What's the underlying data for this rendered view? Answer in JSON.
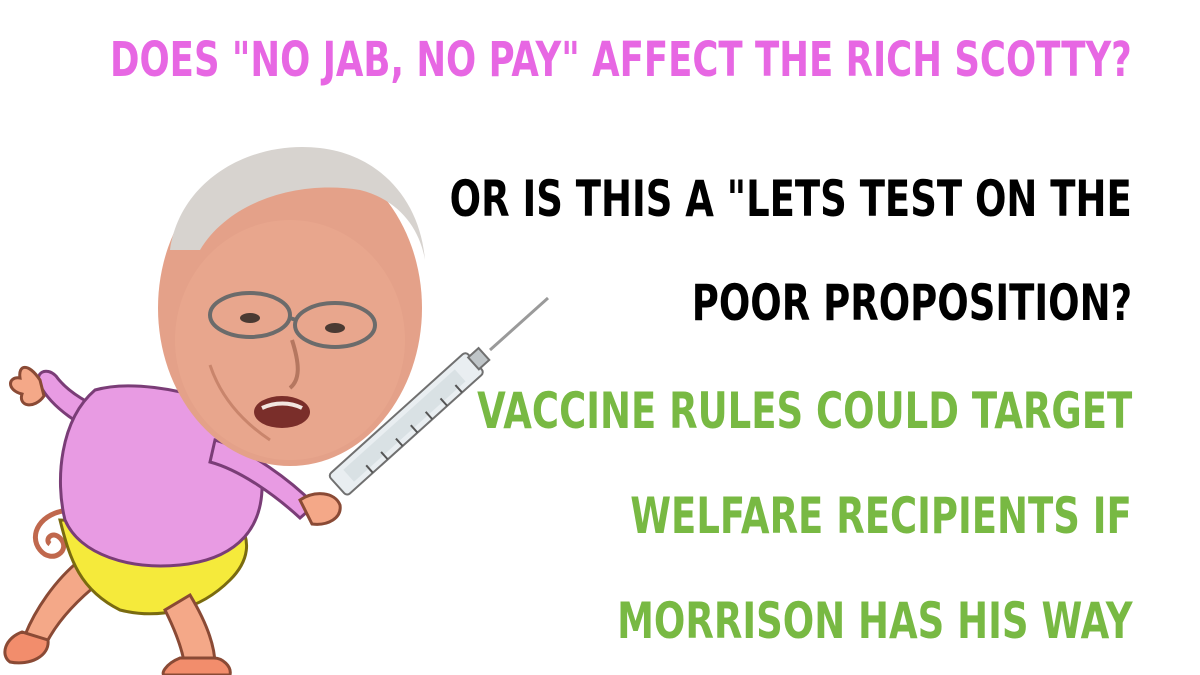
{
  "meme": {
    "headline": "DOES \"NO JAB, NO PAY\" AFFECT THE RICH SCOTTY?",
    "question_line_1": "OR IS THIS A \"LETS TEST ON THE",
    "question_line_2": "POOR PROPOSITION?",
    "answer_line_1": "VACCINE RULES COULD TARGET",
    "answer_line_2": "WELFARE RECIPIENTS IF",
    "answer_line_3": "MORRISON HAS HIS WAY"
  },
  "colors": {
    "headline": "#e767e3",
    "question": "#000000",
    "answer": "#78b943",
    "shirt": "#e89be3",
    "shorts": "#f5ea3b",
    "skin_cartoon": "#f4a888"
  },
  "illustration": {
    "subject": "cartoon-runner-with-photo-head-holding-syringe"
  }
}
